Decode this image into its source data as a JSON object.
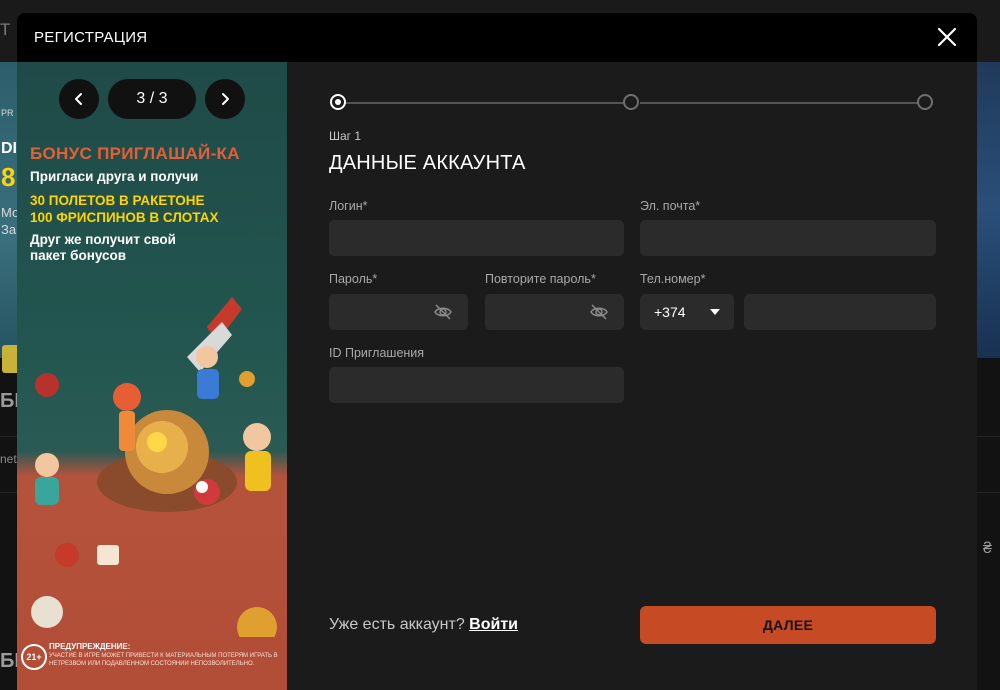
{
  "background": {
    "nav_letter": "Т",
    "side_texts": [
      "PR",
      "DI",
      "8",
      "Мо",
      "За"
    ],
    "row_texts": [
      "БЕ",
      "net",
      "БЕ",
      "₴"
    ]
  },
  "modal": {
    "title": "РЕГИСТРАЦИЯ"
  },
  "promo": {
    "counter": "3 / 3",
    "heading": "БОНУС ПРИГЛАШАЙ-КА",
    "line1": "Пригласи друга и получи",
    "offer1": "30 ПОЛЕТОВ В РАКЕТОНЕ",
    "offer2": "100 ФРИСПИНОВ В СЛОТАХ",
    "line2": "Друг же получит свой",
    "line3": "пакет бонусов",
    "age_badge": "21+",
    "warning_title": "ПРЕДУПРЕЖДЕНИЕ:",
    "warning_text": "УЧАСТИЕ В ИГРЕ МОЖЕТ ПРИВЕСТИ К МАТЕРИАЛЬНЫМ ПОТЕРЯМ ИГРАТЬ В НЕТРЕЗВОМ ИЛИ ПОДАВЛЕННОМ СОСТОЯНИИ НЕПОЗВОЛИТЕЛЬНО."
  },
  "form": {
    "step_label": "Шаг 1",
    "step_title": "ДАННЫЕ АККАУНТА",
    "current_step": 1,
    "total_steps": 3,
    "fields": {
      "login_label": "Логин*",
      "email_label": "Эл. почта*",
      "password_label": "Пароль*",
      "repeat_password_label": "Повторите пароль*",
      "phone_label": "Тел.номер*",
      "phone_code": "+374",
      "invite_label": "ID Приглашения"
    },
    "login_prompt": "Уже есть аккаунт?",
    "login_link": "Войти",
    "next_button": "ДАЛЕЕ"
  },
  "colors": {
    "accent": "#c64a24",
    "modal_bg": "#1b1b1b",
    "input_bg": "#2b2b2b",
    "promo_heading": "#e85e34",
    "promo_offer": "#ffd400"
  }
}
